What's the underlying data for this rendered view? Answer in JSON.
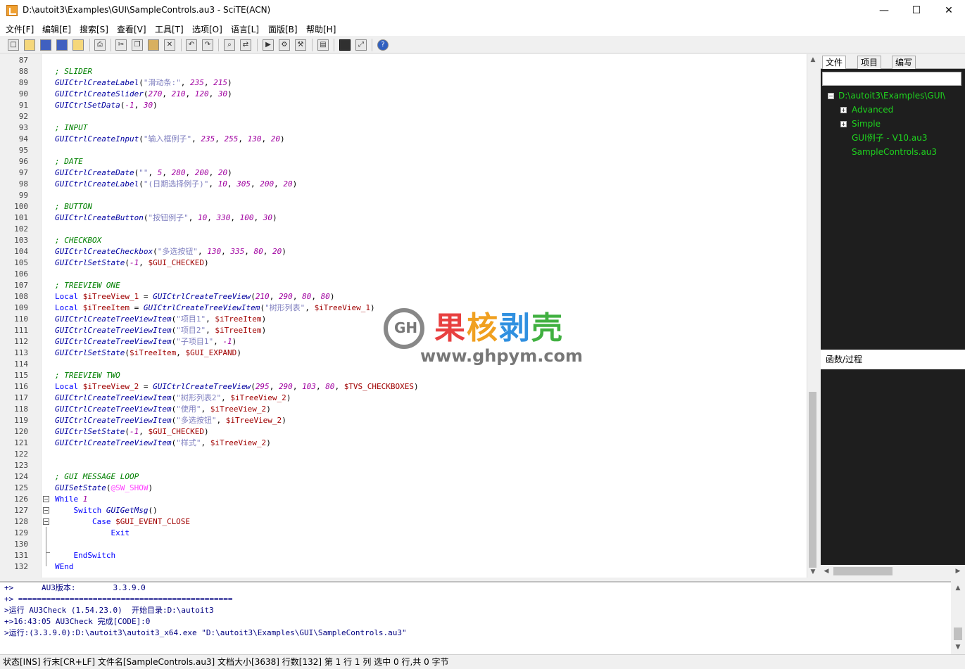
{
  "window": {
    "title": "D:\\autoit3\\Examples\\GUI\\SampleControls.au3 - SciTE(ACN)",
    "minimize": "—",
    "maximize": "☐",
    "close": "✕"
  },
  "menu": [
    "文件[F]",
    "编辑[E]",
    "搜索[S]",
    "查看[V]",
    "工具[T]",
    "选项[O]",
    "语言[L]",
    "面版[B]",
    "帮助[H]"
  ],
  "toolbar_icons": [
    "new-icon",
    "open-icon",
    "save-icon",
    "save-all-icon",
    "open-folder-icon",
    "print-icon",
    "cut-icon",
    "copy-icon",
    "paste-icon",
    "delete-icon",
    "undo-icon",
    "redo-icon",
    "find-icon",
    "replace-icon",
    "run-icon",
    "compile-icon",
    "build-icon",
    "fullscreen-icon",
    "output-toggle-icon",
    "maximize-icon",
    "help-icon"
  ],
  "editor": {
    "lines": [
      {
        "n": "87",
        "parts": []
      },
      {
        "n": "88",
        "parts": [
          [
            "c-comment",
            "; SLIDER"
          ]
        ]
      },
      {
        "n": "89",
        "parts": [
          [
            "c-func",
            "GUICtrlCreateLabel"
          ],
          [
            "c-plain",
            "("
          ],
          [
            "c-str",
            "\"滑动条:\""
          ],
          [
            "c-plain",
            ", "
          ],
          [
            "c-num",
            "235"
          ],
          [
            "c-plain",
            ", "
          ],
          [
            "c-num",
            "215"
          ],
          [
            "c-plain",
            ")"
          ]
        ]
      },
      {
        "n": "90",
        "parts": [
          [
            "c-func",
            "GUICtrlCreateSlider"
          ],
          [
            "c-plain",
            "("
          ],
          [
            "c-num",
            "270"
          ],
          [
            "c-plain",
            ", "
          ],
          [
            "c-num",
            "210"
          ],
          [
            "c-plain",
            ", "
          ],
          [
            "c-num",
            "120"
          ],
          [
            "c-plain",
            ", "
          ],
          [
            "c-num",
            "30"
          ],
          [
            "c-plain",
            ")"
          ]
        ]
      },
      {
        "n": "91",
        "parts": [
          [
            "c-func",
            "GUICtrlSetData"
          ],
          [
            "c-plain",
            "("
          ],
          [
            "c-num",
            "-1"
          ],
          [
            "c-plain",
            ", "
          ],
          [
            "c-num",
            "30"
          ],
          [
            "c-plain",
            ")"
          ]
        ]
      },
      {
        "n": "92",
        "parts": []
      },
      {
        "n": "93",
        "parts": [
          [
            "c-comment",
            "; INPUT"
          ]
        ]
      },
      {
        "n": "94",
        "parts": [
          [
            "c-func",
            "GUICtrlCreateInput"
          ],
          [
            "c-plain",
            "("
          ],
          [
            "c-str",
            "\"输入框例子\""
          ],
          [
            "c-plain",
            ", "
          ],
          [
            "c-num",
            "235"
          ],
          [
            "c-plain",
            ", "
          ],
          [
            "c-num",
            "255"
          ],
          [
            "c-plain",
            ", "
          ],
          [
            "c-num",
            "130"
          ],
          [
            "c-plain",
            ", "
          ],
          [
            "c-num",
            "20"
          ],
          [
            "c-plain",
            ")"
          ]
        ]
      },
      {
        "n": "95",
        "parts": []
      },
      {
        "n": "96",
        "parts": [
          [
            "c-comment",
            "; DATE"
          ]
        ]
      },
      {
        "n": "97",
        "parts": [
          [
            "c-func",
            "GUICtrlCreateDate"
          ],
          [
            "c-plain",
            "("
          ],
          [
            "c-str",
            "\"\""
          ],
          [
            "c-plain",
            ", "
          ],
          [
            "c-num",
            "5"
          ],
          [
            "c-plain",
            ", "
          ],
          [
            "c-num",
            "280"
          ],
          [
            "c-plain",
            ", "
          ],
          [
            "c-num",
            "200"
          ],
          [
            "c-plain",
            ", "
          ],
          [
            "c-num",
            "20"
          ],
          [
            "c-plain",
            ")"
          ]
        ]
      },
      {
        "n": "98",
        "parts": [
          [
            "c-func",
            "GUICtrlCreateLabel"
          ],
          [
            "c-plain",
            "("
          ],
          [
            "c-str",
            "\"(日期选择例子)\""
          ],
          [
            "c-plain",
            ", "
          ],
          [
            "c-num",
            "10"
          ],
          [
            "c-plain",
            ", "
          ],
          [
            "c-num",
            "305"
          ],
          [
            "c-plain",
            ", "
          ],
          [
            "c-num",
            "200"
          ],
          [
            "c-plain",
            ", "
          ],
          [
            "c-num",
            "20"
          ],
          [
            "c-plain",
            ")"
          ]
        ]
      },
      {
        "n": "99",
        "parts": []
      },
      {
        "n": "100",
        "parts": [
          [
            "c-comment",
            "; BUTTON"
          ]
        ]
      },
      {
        "n": "101",
        "parts": [
          [
            "c-func",
            "GUICtrlCreateButton"
          ],
          [
            "c-plain",
            "("
          ],
          [
            "c-str",
            "\"按钮例子\""
          ],
          [
            "c-plain",
            ", "
          ],
          [
            "c-num",
            "10"
          ],
          [
            "c-plain",
            ", "
          ],
          [
            "c-num",
            "330"
          ],
          [
            "c-plain",
            ", "
          ],
          [
            "c-num",
            "100"
          ],
          [
            "c-plain",
            ", "
          ],
          [
            "c-num",
            "30"
          ],
          [
            "c-plain",
            ")"
          ]
        ]
      },
      {
        "n": "102",
        "parts": []
      },
      {
        "n": "103",
        "parts": [
          [
            "c-comment",
            "; CHECKBOX"
          ]
        ]
      },
      {
        "n": "104",
        "parts": [
          [
            "c-func",
            "GUICtrlCreateCheckbox"
          ],
          [
            "c-plain",
            "("
          ],
          [
            "c-str",
            "\"多选按钮\""
          ],
          [
            "c-plain",
            ", "
          ],
          [
            "c-num",
            "130"
          ],
          [
            "c-plain",
            ", "
          ],
          [
            "c-num",
            "335"
          ],
          [
            "c-plain",
            ", "
          ],
          [
            "c-num",
            "80"
          ],
          [
            "c-plain",
            ", "
          ],
          [
            "c-num",
            "20"
          ],
          [
            "c-plain",
            ")"
          ]
        ]
      },
      {
        "n": "105",
        "parts": [
          [
            "c-func",
            "GUICtrlSetState"
          ],
          [
            "c-plain",
            "("
          ],
          [
            "c-num",
            "-1"
          ],
          [
            "c-plain",
            ", "
          ],
          [
            "c-var",
            "$GUI_CHECKED"
          ],
          [
            "c-plain",
            ")"
          ]
        ]
      },
      {
        "n": "106",
        "parts": []
      },
      {
        "n": "107",
        "parts": [
          [
            "c-comment",
            "; TREEVIEW ONE"
          ]
        ]
      },
      {
        "n": "108",
        "parts": [
          [
            "c-kw",
            "Local "
          ],
          [
            "c-var",
            "$iTreeView_1"
          ],
          [
            "c-plain",
            " = "
          ],
          [
            "c-func",
            "GUICtrlCreateTreeView"
          ],
          [
            "c-plain",
            "("
          ],
          [
            "c-num",
            "210"
          ],
          [
            "c-plain",
            ", "
          ],
          [
            "c-num",
            "290"
          ],
          [
            "c-plain",
            ", "
          ],
          [
            "c-num",
            "80"
          ],
          [
            "c-plain",
            ", "
          ],
          [
            "c-num",
            "80"
          ],
          [
            "c-plain",
            ")"
          ]
        ]
      },
      {
        "n": "109",
        "parts": [
          [
            "c-kw",
            "Local "
          ],
          [
            "c-var",
            "$iTreeItem"
          ],
          [
            "c-plain",
            " = "
          ],
          [
            "c-func",
            "GUICtrlCreateTreeViewItem"
          ],
          [
            "c-plain",
            "("
          ],
          [
            "c-str",
            "\"树形列表\""
          ],
          [
            "c-plain",
            ", "
          ],
          [
            "c-var",
            "$iTreeView_1"
          ],
          [
            "c-plain",
            ")"
          ]
        ]
      },
      {
        "n": "110",
        "parts": [
          [
            "c-func",
            "GUICtrlCreateTreeViewItem"
          ],
          [
            "c-plain",
            "("
          ],
          [
            "c-str",
            "\"项目1\""
          ],
          [
            "c-plain",
            ", "
          ],
          [
            "c-var",
            "$iTreeItem"
          ],
          [
            "c-plain",
            ")"
          ]
        ]
      },
      {
        "n": "111",
        "parts": [
          [
            "c-func",
            "GUICtrlCreateTreeViewItem"
          ],
          [
            "c-plain",
            "("
          ],
          [
            "c-str",
            "\"项目2\""
          ],
          [
            "c-plain",
            ", "
          ],
          [
            "c-var",
            "$iTreeItem"
          ],
          [
            "c-plain",
            ")"
          ]
        ]
      },
      {
        "n": "112",
        "parts": [
          [
            "c-func",
            "GUICtrlCreateTreeViewItem"
          ],
          [
            "c-plain",
            "("
          ],
          [
            "c-str",
            "\"子项目1\""
          ],
          [
            "c-plain",
            ", "
          ],
          [
            "c-num",
            "-1"
          ],
          [
            "c-plain",
            ")"
          ]
        ]
      },
      {
        "n": "113",
        "parts": [
          [
            "c-func",
            "GUICtrlSetState"
          ],
          [
            "c-plain",
            "("
          ],
          [
            "c-var",
            "$iTreeItem"
          ],
          [
            "c-plain",
            ", "
          ],
          [
            "c-var",
            "$GUI_EXPAND"
          ],
          [
            "c-plain",
            ")"
          ]
        ]
      },
      {
        "n": "114",
        "parts": []
      },
      {
        "n": "115",
        "parts": [
          [
            "c-comment",
            "; TREEVIEW TWO"
          ]
        ]
      },
      {
        "n": "116",
        "parts": [
          [
            "c-kw",
            "Local "
          ],
          [
            "c-var",
            "$iTreeView_2"
          ],
          [
            "c-plain",
            " = "
          ],
          [
            "c-func",
            "GUICtrlCreateTreeView"
          ],
          [
            "c-plain",
            "("
          ],
          [
            "c-num",
            "295"
          ],
          [
            "c-plain",
            ", "
          ],
          [
            "c-num",
            "290"
          ],
          [
            "c-plain",
            ", "
          ],
          [
            "c-num",
            "103"
          ],
          [
            "c-plain",
            ", "
          ],
          [
            "c-num",
            "80"
          ],
          [
            "c-plain",
            ", "
          ],
          [
            "c-var",
            "$TVS_CHECKBOXES"
          ],
          [
            "c-plain",
            ")"
          ]
        ]
      },
      {
        "n": "117",
        "parts": [
          [
            "c-func",
            "GUICtrlCreateTreeViewItem"
          ],
          [
            "c-plain",
            "("
          ],
          [
            "c-str",
            "\"树形列表2\""
          ],
          [
            "c-plain",
            ", "
          ],
          [
            "c-var",
            "$iTreeView_2"
          ],
          [
            "c-plain",
            ")"
          ]
        ]
      },
      {
        "n": "118",
        "parts": [
          [
            "c-func",
            "GUICtrlCreateTreeViewItem"
          ],
          [
            "c-plain",
            "("
          ],
          [
            "c-str",
            "\"使用\""
          ],
          [
            "c-plain",
            ", "
          ],
          [
            "c-var",
            "$iTreeView_2"
          ],
          [
            "c-plain",
            ")"
          ]
        ]
      },
      {
        "n": "119",
        "parts": [
          [
            "c-func",
            "GUICtrlCreateTreeViewItem"
          ],
          [
            "c-plain",
            "("
          ],
          [
            "c-str",
            "\"多选按钮\""
          ],
          [
            "c-plain",
            ", "
          ],
          [
            "c-var",
            "$iTreeView_2"
          ],
          [
            "c-plain",
            ")"
          ]
        ]
      },
      {
        "n": "120",
        "parts": [
          [
            "c-func",
            "GUICtrlSetState"
          ],
          [
            "c-plain",
            "("
          ],
          [
            "c-num",
            "-1"
          ],
          [
            "c-plain",
            ", "
          ],
          [
            "c-var",
            "$GUI_CHECKED"
          ],
          [
            "c-plain",
            ")"
          ]
        ]
      },
      {
        "n": "121",
        "parts": [
          [
            "c-func",
            "GUICtrlCreateTreeViewItem"
          ],
          [
            "c-plain",
            "("
          ],
          [
            "c-str",
            "\"样式\""
          ],
          [
            "c-plain",
            ", "
          ],
          [
            "c-var",
            "$iTreeView_2"
          ],
          [
            "c-plain",
            ")"
          ]
        ]
      },
      {
        "n": "122",
        "parts": []
      },
      {
        "n": "123",
        "parts": []
      },
      {
        "n": "124",
        "parts": [
          [
            "c-comment",
            "; GUI MESSAGE LOOP"
          ]
        ]
      },
      {
        "n": "125",
        "parts": [
          [
            "c-func",
            "GUISetState"
          ],
          [
            "c-plain",
            "("
          ],
          [
            "c-macro",
            "@SW_SHOW"
          ],
          [
            "c-plain",
            ")"
          ]
        ]
      },
      {
        "n": "126",
        "parts": [
          [
            "c-kw",
            "While "
          ],
          [
            "c-num",
            "1"
          ]
        ]
      },
      {
        "n": "127",
        "parts": [
          [
            "c-kw",
            "    Switch "
          ],
          [
            "c-func",
            "GUIGetMsg"
          ],
          [
            "c-plain",
            "()"
          ]
        ]
      },
      {
        "n": "128",
        "parts": [
          [
            "c-kw",
            "        Case "
          ],
          [
            "c-var",
            "$GUI_EVENT_CLOSE"
          ]
        ]
      },
      {
        "n": "129",
        "parts": [
          [
            "c-kw",
            "            Exit"
          ]
        ]
      },
      {
        "n": "130",
        "parts": []
      },
      {
        "n": "131",
        "parts": [
          [
            "c-kw",
            "    EndSwitch"
          ]
        ]
      },
      {
        "n": "132",
        "parts": [
          [
            "c-kw",
            "WEnd"
          ]
        ]
      }
    ]
  },
  "sidebar": {
    "tabs": [
      "文件",
      "项目",
      "编写"
    ],
    "tree": {
      "root": "D:\\autoit3\\Examples\\GUI\\",
      "items": [
        {
          "label": "Advanced",
          "expandable": true
        },
        {
          "label": "Simple",
          "expandable": true
        },
        {
          "label": "GUI例子 - V10.au3",
          "expandable": false
        },
        {
          "label": "SampleControls.au3",
          "expandable": false
        }
      ]
    },
    "functions_label": "函数/过程"
  },
  "output": {
    "lines": [
      "+>      AU3版本:        3.3.9.0",
      "+> ==============================================",
      ">运行 AU3Check (1.54.23.0)  开始目录:D:\\autoit3",
      "+>16:43:05 AU3Check 完成[CODE]:0",
      ">运行:(3.3.9.0):D:\\autoit3\\autoit3_x64.exe \"D:\\autoit3\\Examples\\GUI\\SampleControls.au3\""
    ]
  },
  "status": "状态[INS] 行末[CR+LF] 文件名[SampleControls.au3] 文档大小[3638] 行数[132] 第 1 行 1 列 选中 0 行,共 0 字节",
  "watermark": {
    "text": "果核剥壳",
    "url": "www.ghpym.com",
    "logo": "GH"
  }
}
